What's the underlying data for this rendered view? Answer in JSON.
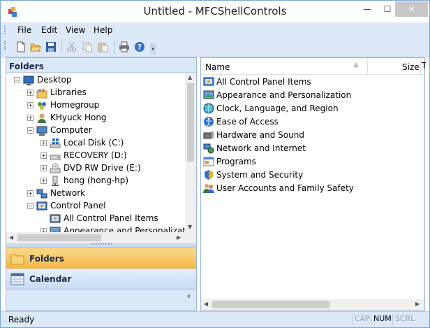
{
  "window": {
    "title": "Untitled - MFCShellControls",
    "close_glyph": "✕",
    "minimize_glyph": "—",
    "maximize_glyph": "☐"
  },
  "menu": [
    "File",
    "Edit",
    "View",
    "Help"
  ],
  "toolbar": [
    "new-doc-icon",
    "open-folder-icon",
    "save-icon",
    "cut-icon",
    "copy-icon",
    "paste-icon",
    "print-icon",
    "help-icon"
  ],
  "left_pane": {
    "header": "Folders",
    "tree": [
      {
        "label": "Desktop",
        "icon": "desktop-icon",
        "expander": "−"
      },
      {
        "label": "Libraries",
        "icon": "libraries-icon",
        "expander": "+"
      },
      {
        "label": "Homegroup",
        "icon": "homegroup-icon",
        "expander": "+"
      },
      {
        "label": "KHyuck Hong",
        "icon": "user-icon",
        "expander": "+"
      },
      {
        "label": "Computer",
        "icon": "computer-icon",
        "expander": "−"
      },
      {
        "label": "Local Disk (C:)",
        "icon": "windows-drive-icon",
        "expander": "+"
      },
      {
        "label": "RECOVERY (D:)",
        "icon": "drive-icon",
        "expander": "+"
      },
      {
        "label": "DVD RW Drive (E:)",
        "icon": "dvd-drive-icon",
        "expander": "+"
      },
      {
        "label": "hong (hong-hp)",
        "icon": "network-drive-icon",
        "expander": "+"
      },
      {
        "label": "Network",
        "icon": "network-icon",
        "expander": "+"
      },
      {
        "label": "Control Panel",
        "icon": "control-panel-icon",
        "expander": "−"
      },
      {
        "label": "All Control Panel Items",
        "icon": "control-panel-icon",
        "expander": ""
      },
      {
        "label": "Appearance and Personalization",
        "icon": "appearance-icon",
        "expander": "+"
      }
    ]
  },
  "outlook_bar": {
    "folders": "Folders",
    "calendar": "Calendar",
    "chevron": "»",
    "splitter": "•••••••••"
  },
  "right_pane": {
    "columns": {
      "name": "Name",
      "size": "Size",
      "type": "T"
    },
    "items": [
      {
        "label": "All Control Panel Items",
        "icon": "control-panel-icon"
      },
      {
        "label": "Appearance and Personalization",
        "icon": "appearance-icon"
      },
      {
        "label": "Clock, Language, and Region",
        "icon": "clock-globe-icon"
      },
      {
        "label": "Ease of Access",
        "icon": "ease-of-access-icon"
      },
      {
        "label": "Hardware and Sound",
        "icon": "hardware-icon"
      },
      {
        "label": "Network and Internet",
        "icon": "network-internet-icon"
      },
      {
        "label": "Programs",
        "icon": "programs-icon"
      },
      {
        "label": "System and Security",
        "icon": "security-shield-icon"
      },
      {
        "label": "User Accounts and Family Safety",
        "icon": "users-icon"
      }
    ]
  },
  "status": {
    "text": "Ready",
    "cap": "CAP",
    "num": "NUM",
    "scrl": "SCRL"
  }
}
